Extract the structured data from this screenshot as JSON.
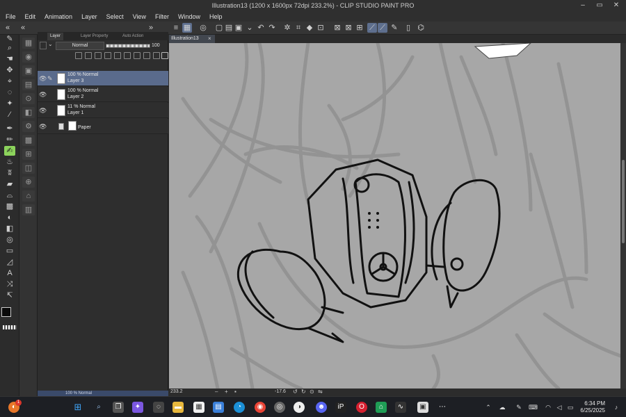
{
  "window": {
    "title": "Illustration13 (1200 x 1600px 72dpi 233.2%) - CLIP STUDIO PAINT PRO"
  },
  "menu": [
    "File",
    "Edit",
    "Animation",
    "Layer",
    "Select",
    "View",
    "Filter",
    "Window",
    "Help"
  ],
  "panel_tabs": {
    "layer": "Layer",
    "layer_property": "Layer Property",
    "auto_action": "Auto Action"
  },
  "layer_panel": {
    "blend_mode": "Normal",
    "opacity": "100",
    "layers": [
      {
        "mode": "100 % Normal",
        "name": "Layer 3",
        "selected": true
      },
      {
        "mode": "100 % Normal",
        "name": "Layer 2",
        "selected": false
      },
      {
        "mode": "11 % Normal",
        "name": "Layer 1",
        "selected": false
      },
      {
        "mode": "",
        "name": "Paper",
        "selected": false
      }
    ],
    "bottom_label": "100 % Normal"
  },
  "document_tab": {
    "label": "Illustration13",
    "close": "×"
  },
  "status": {
    "zoom": "233.2",
    "angle": "-17.6"
  },
  "taskbar": {
    "time": "6:34 PM",
    "date": "6/25/2025",
    "badge_count": "1"
  },
  "colors": {
    "accent": "#5a6b8c",
    "tool_highlight": "#8cd35c",
    "canvas_bg": "#a7a7a7",
    "line": "#111111",
    "sketch": "#8f8f8f"
  }
}
